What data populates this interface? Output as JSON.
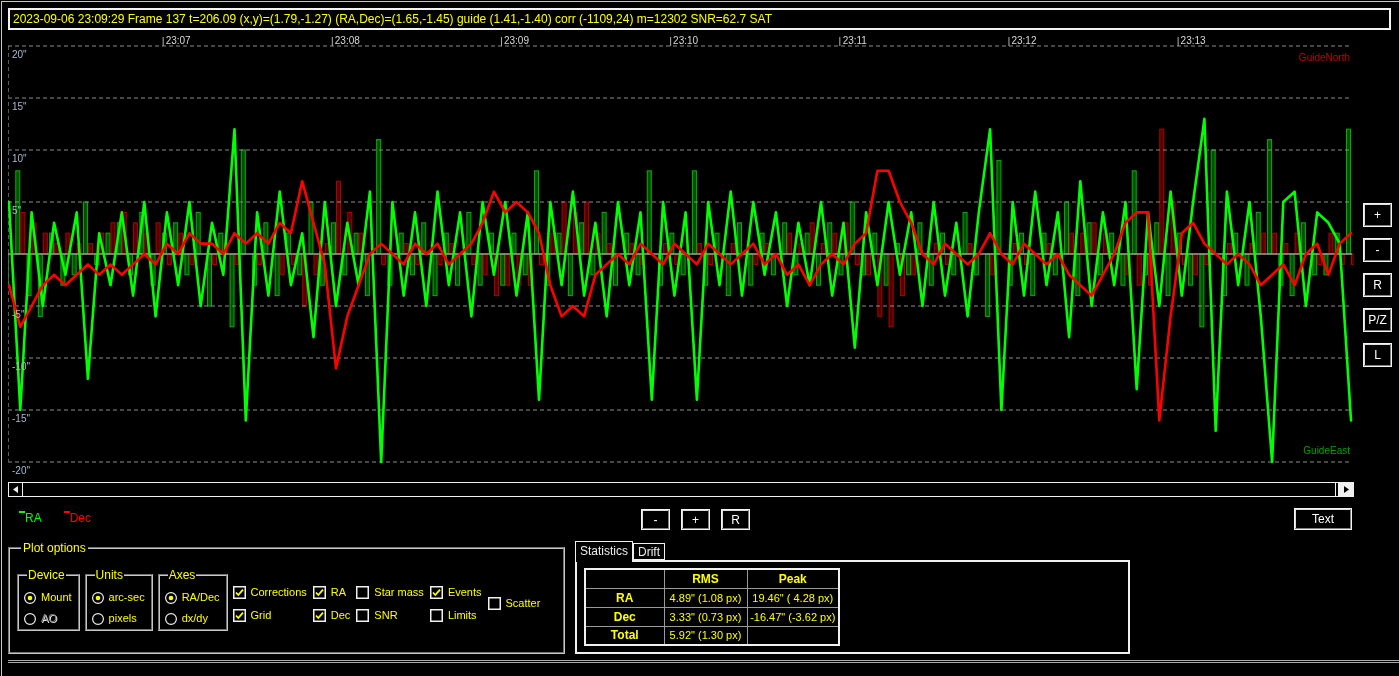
{
  "info_bar": {
    "text": "2023-09-06 23:09:29 Frame 137 t=206.09 (x,y)=(1.79,-1.27) (RA,Dec)=(1.65,-1.45) guide (1.41,-1.40) corr (-1109,24) m=12302 SNR=62.7 SAT"
  },
  "graph": {
    "chart_data": {
      "type": "line",
      "grid": true,
      "ylim": [
        -20,
        20
      ],
      "categories": [
        null,
        null,
        null,
        null,
        null,
        null,
        null,
        null,
        null,
        null,
        null,
        null,
        null,
        null,
        null,
        "23:07",
        null,
        null,
        null,
        null,
        null,
        null,
        null,
        null,
        null,
        null,
        null,
        null,
        null,
        null,
        "23:08",
        null,
        null,
        null,
        null,
        null,
        null,
        null,
        null,
        null,
        null,
        null,
        null,
        null,
        null,
        "23:09",
        null,
        null,
        null,
        null,
        null,
        null,
        null,
        null,
        null,
        null,
        null,
        null,
        null,
        null,
        "23:10",
        null,
        null,
        null,
        null,
        null,
        null,
        null,
        null,
        null,
        null,
        null,
        null,
        null,
        null,
        "23:11",
        null,
        null,
        null,
        null,
        null,
        null,
        null,
        null,
        null,
        null,
        null,
        null,
        null,
        null,
        "23:12",
        null,
        null,
        null,
        null,
        null,
        null,
        null,
        null,
        null,
        null,
        null,
        null,
        null,
        null,
        "23:13",
        null,
        null,
        null,
        null,
        null,
        null,
        null,
        null,
        null,
        null,
        null,
        null,
        null,
        null
      ],
      "yticks": [
        {
          "value": 20,
          "label": "20\""
        },
        {
          "value": 15,
          "label": "15\""
        },
        {
          "value": 10,
          "label": "10\""
        },
        {
          "value": 5,
          "label": "5\""
        },
        {
          "value": -5,
          "label": "-5\""
        },
        {
          "value": -10,
          "label": "-10\""
        },
        {
          "value": -15,
          "label": "-15\""
        },
        {
          "value": -20,
          "label": "-20\""
        }
      ],
      "annotations": [
        {
          "text": "GuideNorth"
        },
        {
          "text": "GuideEast"
        }
      ],
      "series": [
        {
          "name": "RA",
          "color": "#00ff00",
          "values": [
            5,
            -15,
            4,
            -5,
            3,
            -2,
            4,
            -12,
            2,
            -3,
            4,
            -4,
            5,
            -6,
            4,
            -3,
            5,
            -5,
            3,
            -2,
            12,
            -16,
            4,
            -4,
            6,
            -3,
            2,
            -8,
            5,
            -5,
            3,
            -3,
            6,
            -20,
            5,
            -4,
            4,
            -5,
            6,
            -3,
            4,
            -6,
            5,
            -2,
            5,
            -4,
            4,
            -14,
            5,
            -3,
            6,
            -4,
            3,
            -6,
            5,
            -3,
            4,
            -14,
            5,
            -4,
            4,
            -14,
            5,
            -3,
            6,
            -4,
            5,
            -2,
            4,
            -5,
            3,
            -3,
            5,
            -4,
            3,
            -9,
            4,
            -3,
            5,
            -2,
            4,
            -5,
            5,
            -4,
            3,
            -6,
            4,
            12,
            -15,
            5,
            -4,
            6,
            -3,
            4,
            -8,
            7,
            -5,
            4,
            -3,
            5,
            -13,
            4,
            -5,
            6,
            -4,
            5,
            13,
            -17,
            6,
            -3,
            5,
            -6,
            -20,
            5,
            6,
            -5,
            4,
            3,
            1,
            -16
          ]
        },
        {
          "name": "Dec",
          "color": "#ff0000",
          "values": [
            -3,
            -7,
            -5,
            -3,
            -2,
            -3,
            -2,
            -1,
            -2,
            -1,
            -2,
            -1,
            0,
            -1,
            1,
            0,
            2,
            1,
            1,
            0,
            2,
            1,
            2,
            1,
            3,
            2,
            7,
            3,
            -1,
            -11,
            -6,
            -3,
            0,
            1,
            0,
            -1,
            1,
            0,
            1,
            -1,
            0,
            1,
            3,
            6,
            4,
            5,
            4,
            2,
            -3,
            -6,
            -5,
            -6,
            -2,
            -1,
            0,
            -1,
            1,
            0,
            -1,
            1,
            0,
            -1,
            1,
            0,
            -1,
            0,
            1,
            -1,
            0,
            -2,
            -1,
            -3,
            -1,
            0,
            -1,
            1,
            2,
            8,
            8,
            5,
            3,
            0,
            -1,
            1,
            0,
            -1,
            0,
            2,
            0,
            -1,
            1,
            0,
            -1,
            0,
            -2,
            -3,
            -4,
            -2,
            0,
            3,
            4,
            4,
            -16,
            -6,
            2,
            3,
            1,
            0,
            -1,
            0,
            -1,
            -3,
            -2,
            -1,
            -3,
            0,
            1,
            -2,
            1,
            2
          ]
        }
      ]
    }
  },
  "graph_buttons": [
    "+",
    "-",
    "R",
    "P/Z",
    "L"
  ],
  "scale_buttons": [
    "-",
    "+",
    "R"
  ],
  "text_button": "Text",
  "plot_options": {
    "title": "Plot options",
    "groups": [
      {
        "title": "Device",
        "options": [
          {
            "label": "Mount",
            "selected": true,
            "disabled": false
          },
          {
            "label": "AO",
            "selected": false,
            "disabled": true
          }
        ]
      },
      {
        "title": "Units",
        "options": [
          {
            "label": "arc-sec",
            "selected": true,
            "disabled": false
          },
          {
            "label": "pixels",
            "selected": false,
            "disabled": false
          }
        ]
      },
      {
        "title": "Axes",
        "options": [
          {
            "label": "RA/Dec",
            "selected": true,
            "disabled": false
          },
          {
            "label": "dx/dy",
            "selected": false,
            "disabled": false
          }
        ]
      }
    ],
    "checkbox_columns": [
      {
        "items": [
          {
            "label": "Corrections",
            "checked": true
          },
          {
            "label": "Grid",
            "checked": true
          }
        ]
      },
      {
        "items": [
          {
            "label": "RA",
            "checked": true
          },
          {
            "label": "Dec",
            "checked": true
          }
        ]
      },
      {
        "items": [
          {
            "label": "Star mass",
            "checked": false
          },
          {
            "label": "SNR",
            "checked": false
          }
        ]
      },
      {
        "items": [
          {
            "label": "Events",
            "checked": true
          },
          {
            "label": "Limits",
            "checked": false
          }
        ]
      },
      {
        "items": [
          {
            "label": "Scatter",
            "checked": false
          }
        ]
      }
    ]
  },
  "tabs": [
    {
      "label": "Statistics",
      "selected": true
    },
    {
      "label": "Drift",
      "selected": false
    }
  ],
  "statistics_table": {
    "columns": [
      "RMS",
      "Peak"
    ],
    "rows": [
      {
        "label": "RA",
        "cells": [
          "4.89\" (1.08 px)",
          "19.46\" ( 4.28 px)"
        ]
      },
      {
        "label": "Dec",
        "cells": [
          "3.33\" (0.73 px)",
          "-16.47\" (-3.62 px)"
        ]
      },
      {
        "label": "Total",
        "cells": [
          "5.92\" (1.30 px)"
        ]
      }
    ]
  }
}
